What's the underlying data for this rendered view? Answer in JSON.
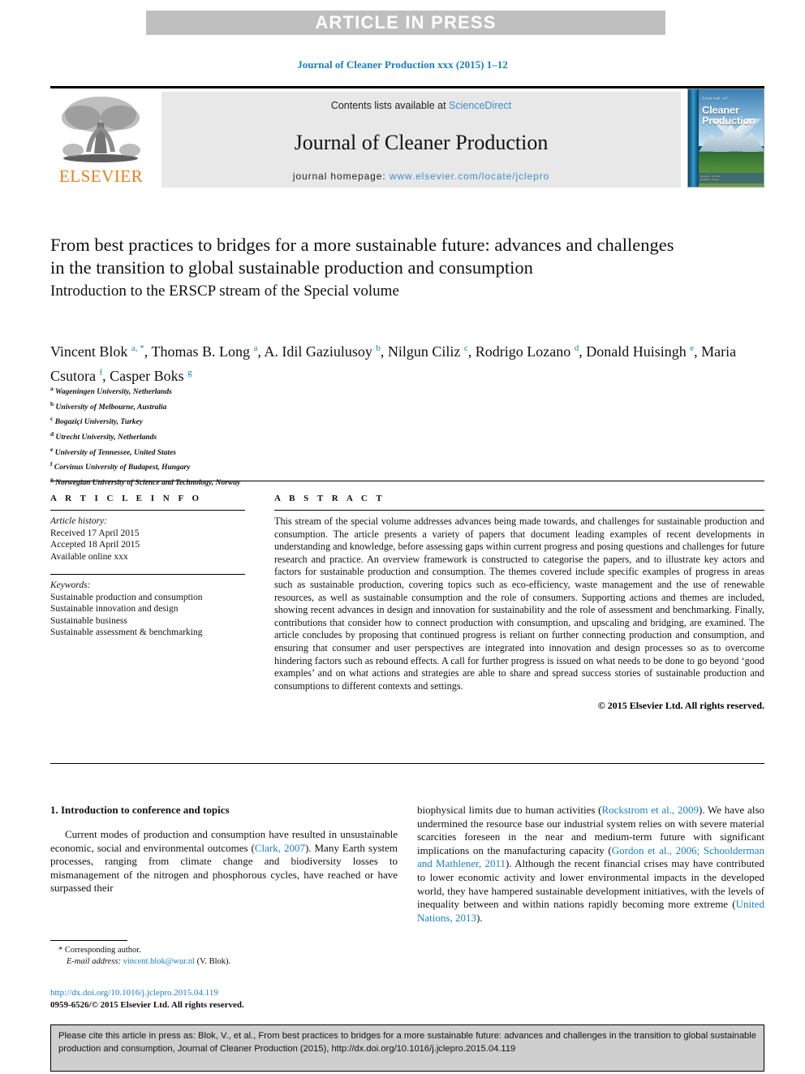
{
  "banner": {
    "text": "ARTICLE IN PRESS"
  },
  "running_head": "Journal of Cleaner Production xxx (2015) 1–12",
  "masthead": {
    "publisher": "ELSEVIER",
    "contents_prefix": "Contents lists available at ",
    "contents_link": "ScienceDirect",
    "journal_title": "Journal of Cleaner Production",
    "homepage_prefix": "journal homepage: ",
    "homepage_url": "www.elsevier.com/locate/jclepro",
    "cover": {
      "pre_title": "Journal of",
      "line1": "Cleaner",
      "line2": "Production"
    }
  },
  "article": {
    "title": "From best practices to bridges for a more sustainable future: advances and challenges in the transition to global sustainable production and consumption",
    "subtitle": "Introduction to the ERSCP stream of the Special volume"
  },
  "authors": {
    "list": [
      {
        "name": "Vincent Blok",
        "marks": "a, *"
      },
      {
        "name": "Thomas B. Long",
        "marks": "a"
      },
      {
        "name": "A. Idil Gaziulusoy",
        "marks": "b"
      },
      {
        "name": "Nilgun Ciliz",
        "marks": "c"
      },
      {
        "name": "Rodrigo Lozano",
        "marks": "d"
      },
      {
        "name": "Donald Huisingh",
        "marks": "e"
      },
      {
        "name": "Maria Csutora",
        "marks": "f"
      },
      {
        "name": "Casper Boks",
        "marks": "g"
      }
    ],
    "affiliations": [
      {
        "mark": "a",
        "text": "Wageningen University, Netherlands"
      },
      {
        "mark": "b",
        "text": "University of Melbourne, Australia"
      },
      {
        "mark": "c",
        "text": "Bogaziçi University, Turkey"
      },
      {
        "mark": "d",
        "text": "Utrecht University, Netherlands"
      },
      {
        "mark": "e",
        "text": "University of Tennessee, United States"
      },
      {
        "mark": "f",
        "text": "Corvinus University of Budapest, Hungary"
      },
      {
        "mark": "g",
        "text": "Norwegian University of Science and Technology, Norway"
      }
    ]
  },
  "article_info": {
    "heading": "A R T I C L E   I N F O",
    "history_label": "Article history:",
    "received": "Received 17 April 2015",
    "accepted": "Accepted 18 April 2015",
    "available": "Available online xxx",
    "keywords_label": "Keywords:",
    "keywords": [
      "Sustainable production and consumption",
      "Sustainable innovation and design",
      "Sustainable business",
      "Sustainable assessment & benchmarking"
    ]
  },
  "abstract": {
    "heading": "A B S T R A C T",
    "text": "This stream of the special volume addresses advances being made towards, and challenges for sustainable production and consumption. The article presents a variety of papers that document leading examples of recent developments in understanding and knowledge, before assessing gaps within current progress and posing questions and challenges for future research and practice. An overview framework is constructed to categorise the papers, and to illustrate key actors and factors for sustainable production and consumption. The themes covered include specific examples of progress in areas such as sustainable production, covering topics such as eco-efficiency, waste management and the use of renewable resources, as well as sustainable consumption and the role of consumers. Supporting actions and themes are included, showing recent advances in design and innovation for sustainability and the role of assessment and benchmarking. Finally, contributions that consider how to connect production with consumption, and upscaling and bridging, are examined. The article concludes by proposing that continued progress is reliant on further connecting production and consumption, and ensuring that consumer and user perspectives are integrated into innovation and design processes so as to overcome hindering factors such as rebound effects. A call for further progress is issued on what needs to be done to go beyond ‘good examples’ and on what actions and strategies are able to share and spread success stories of sustainable production and consumptions to different contexts and settings.",
    "copyright": "© 2015 Elsevier Ltd. All rights reserved."
  },
  "body": {
    "section_heading": "1. Introduction to conference and topics",
    "left_paragraph_1": "Current modes of production and consumption have resulted in unsustainable economic, social and environmental outcomes (",
    "left_cite_1": "Clark, 2007",
    "left_paragraph_1b": "). Many Earth system processes, ranging from climate change and biodiversity losses to mismanagement of the nitrogen and phosphorous cycles, have reached or have surpassed their",
    "right_paragraph_1a": "biophysical limits due to human activities (",
    "right_cite_1": "Rockstrom et al., 2009",
    "right_paragraph_1b": "). We have also undermined the resource base our industrial system relies on with severe material scarcities foreseen in the near and medium-term future with significant implications on the manufacturing capacity (",
    "right_cite_2": "Gordon et al., 2006; Schoolderman and Mathlener, 2011",
    "right_paragraph_1c": "). Although the recent financial crises may have contributed to lower economic activity and lower environmental impacts in the developed world, they have hampered sustainable development initiatives, with the levels of inequality between and within nations rapidly becoming more extreme (",
    "right_cite_3": "United Nations, 2013",
    "right_paragraph_1d": ")."
  },
  "footnote": {
    "corresponding": "* Corresponding author.",
    "email_label": "E-mail address:",
    "email": "vincent.blok@wur.nl",
    "email_suffix": "(V. Blok)."
  },
  "doi": {
    "link": "http://dx.doi.org/10.1016/j.jclepro.2015.04.119",
    "issn": "0959-6526/© 2015 Elsevier Ltd. All rights reserved."
  },
  "citation_box": {
    "text": "Please cite this article in press as: Blok, V., et al., From best practices to bridges for a more sustainable future: advances and challenges in the transition to global sustainable production and consumption, Journal of Cleaner Production (2015), http://dx.doi.org/10.1016/j.jclepro.2015.04.119"
  },
  "colors": {
    "link": "#1a7fc1",
    "banner_bg": "#bfbfbf",
    "masthead_bg": "#e8e8e8",
    "elsevier_orange": "#ef7d1a",
    "citebox_bg": "#cfcfcf"
  }
}
